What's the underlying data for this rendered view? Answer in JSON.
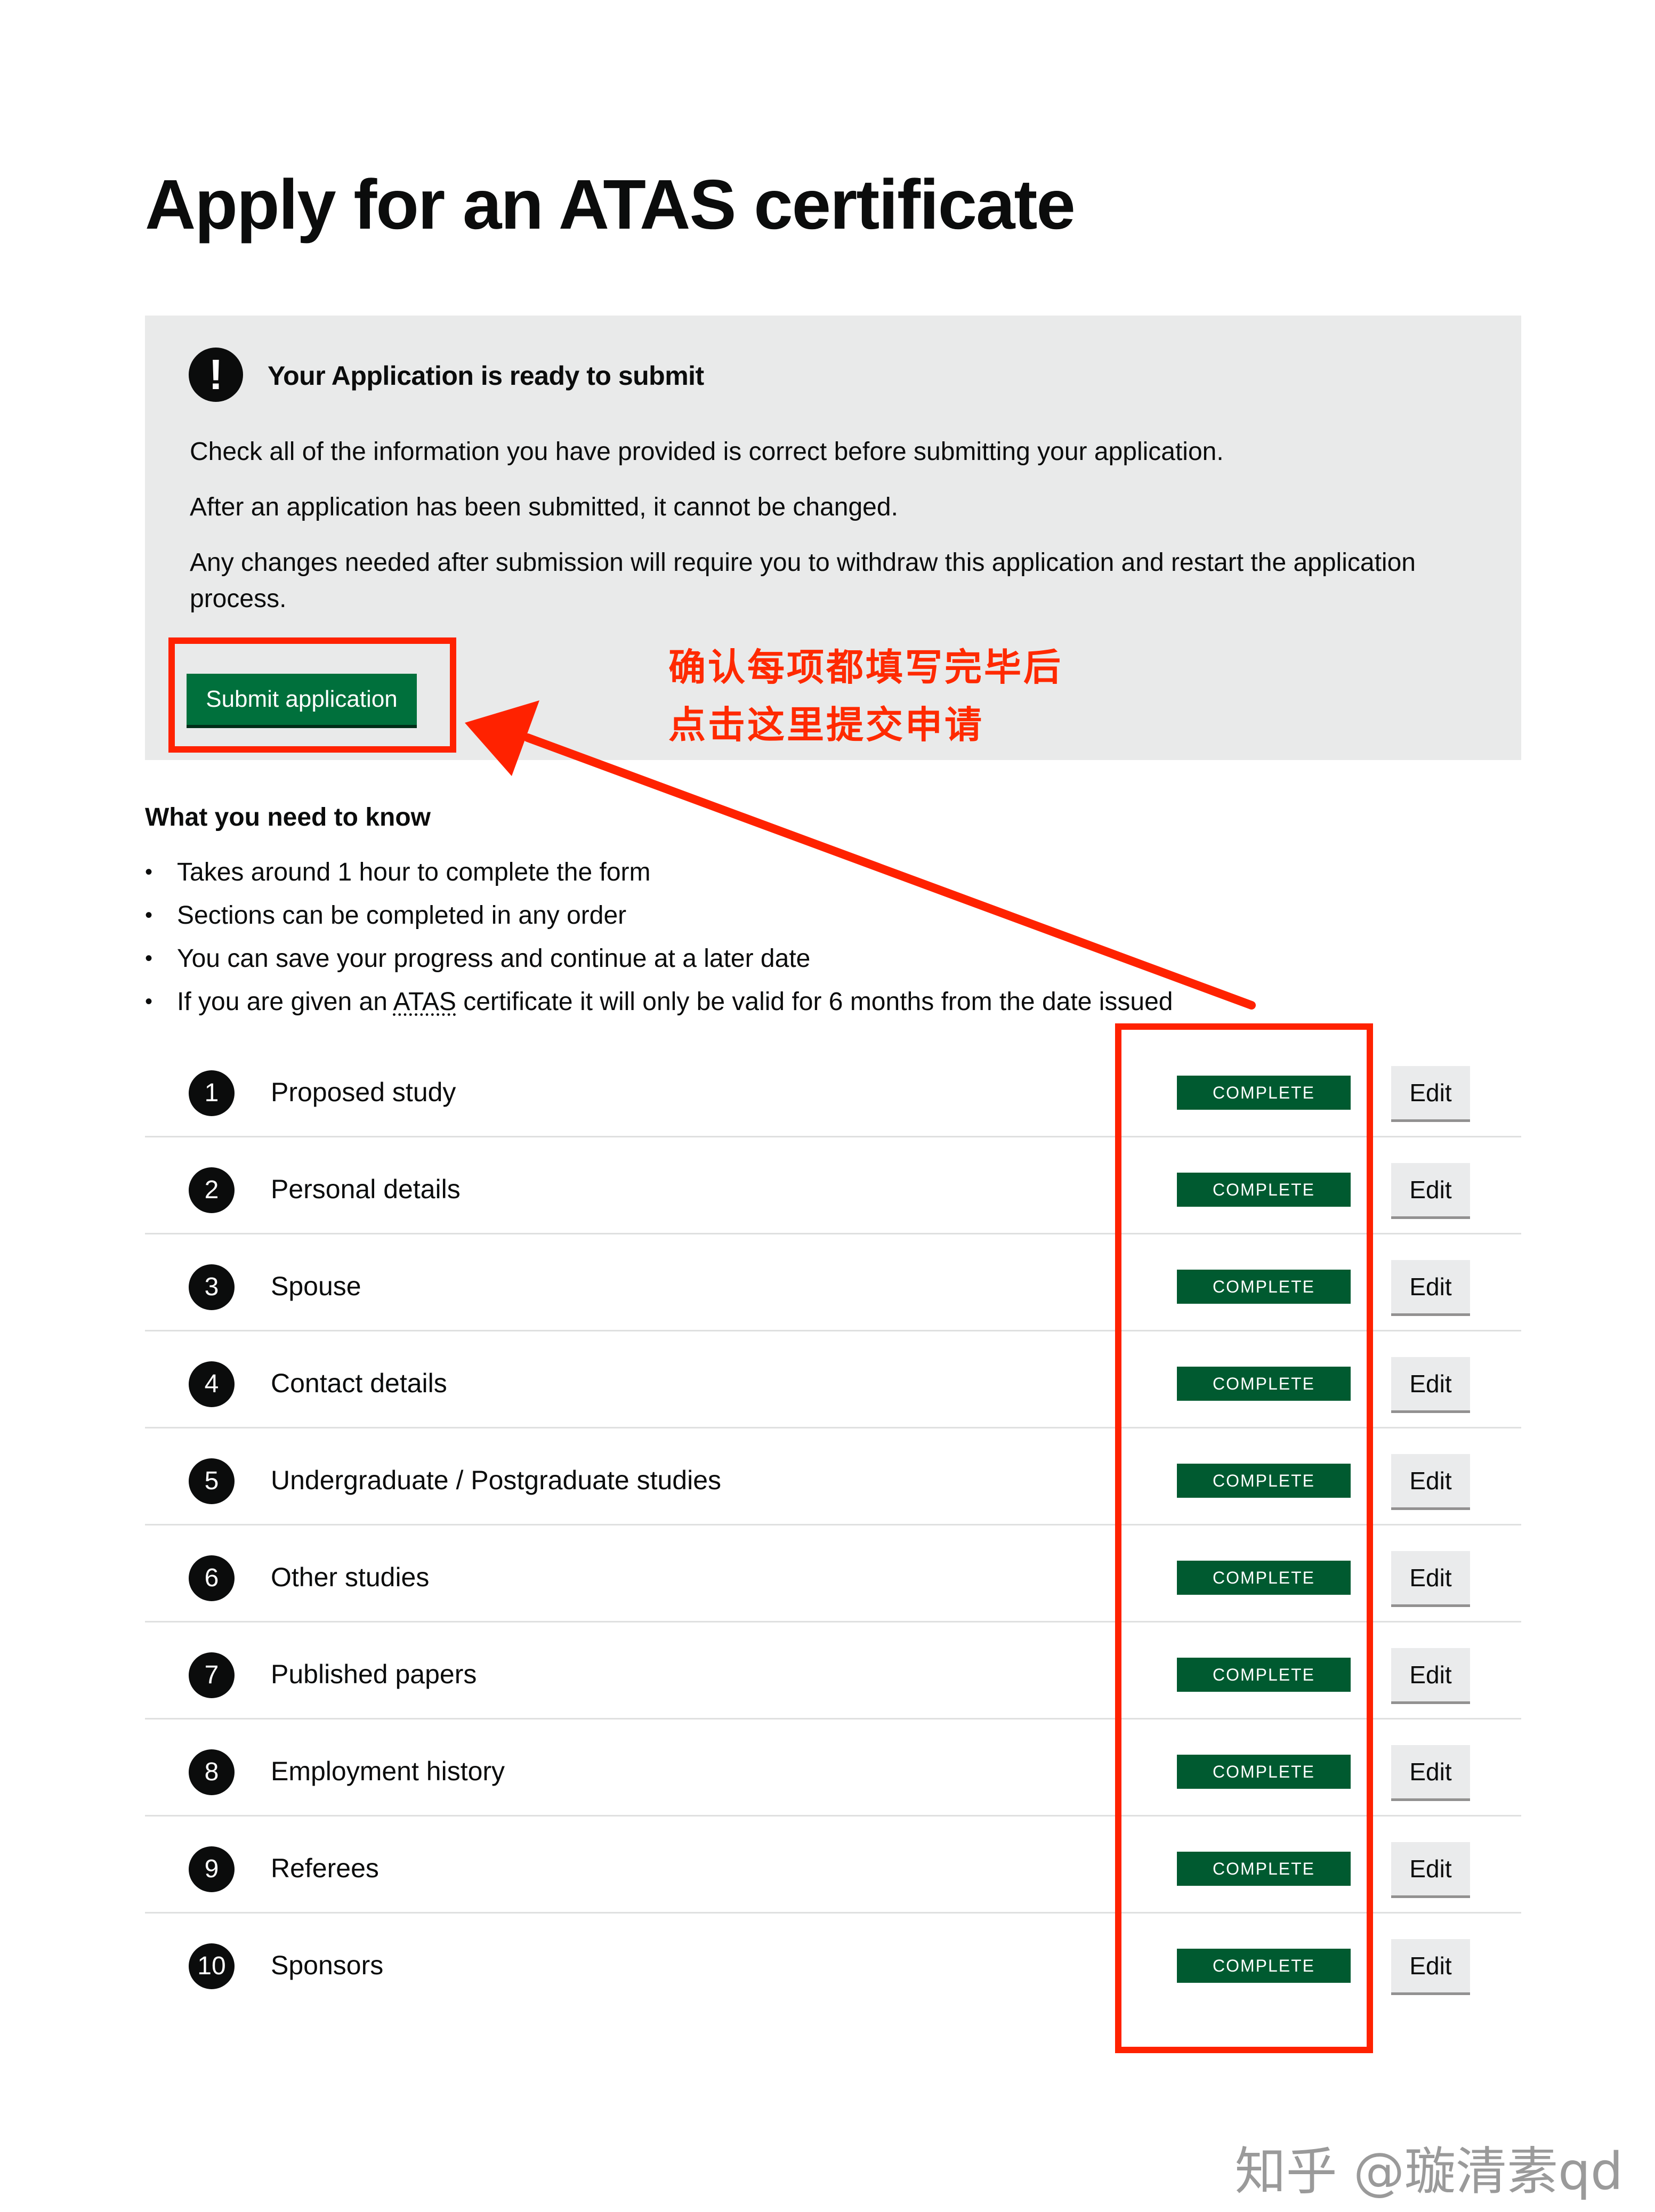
{
  "page": {
    "title": "Apply for an ATAS certificate"
  },
  "notice": {
    "icon": "!",
    "heading": "Your Application is ready to submit",
    "paragraphs": [
      "Check all of the information you have provided is correct before submitting your application.",
      "After an application has been submitted, it cannot be changed.",
      "Any changes needed after submission will require you to withdraw this application and restart the application process."
    ],
    "submit_label": "Submit application"
  },
  "annotation": {
    "lines": [
      "确认每项都填写完毕后",
      "点击这里提交申请"
    ],
    "color": "#ff2200"
  },
  "know": {
    "heading": "What you need to know",
    "items": [
      "Takes around 1 hour to complete the form",
      "Sections can be completed in any order",
      "You can save your progress and continue at a later date"
    ],
    "last_item_prefix": "If you are given an ",
    "last_item_abbr": "ATAS",
    "last_item_suffix": " certificate it will only be valid for 6 months from the date issued"
  },
  "tasks": [
    {
      "number": "1",
      "label": "Proposed study",
      "status": "COMPLETE",
      "action": "Edit"
    },
    {
      "number": "2",
      "label": "Personal details",
      "status": "COMPLETE",
      "action": "Edit"
    },
    {
      "number": "3",
      "label": "Spouse",
      "status": "COMPLETE",
      "action": "Edit"
    },
    {
      "number": "4",
      "label": "Contact details",
      "status": "COMPLETE",
      "action": "Edit"
    },
    {
      "number": "5",
      "label": "Undergraduate / Postgraduate studies",
      "status": "COMPLETE",
      "action": "Edit"
    },
    {
      "number": "6",
      "label": "Other studies",
      "status": "COMPLETE",
      "action": "Edit"
    },
    {
      "number": "7",
      "label": "Published papers",
      "status": "COMPLETE",
      "action": "Edit"
    },
    {
      "number": "8",
      "label": "Employment history",
      "status": "COMPLETE",
      "action": "Edit"
    },
    {
      "number": "9",
      "label": "Referees",
      "status": "COMPLETE",
      "action": "Edit"
    },
    {
      "number": "10",
      "label": "Sponsors",
      "status": "COMPLETE",
      "action": "Edit"
    }
  ],
  "colors": {
    "submit_green": "#00703c",
    "complete_tag": "#005a30",
    "notice_bg": "#e9eaea",
    "highlight_red": "#ff2200"
  },
  "watermark": "知乎 @璇清素qd"
}
